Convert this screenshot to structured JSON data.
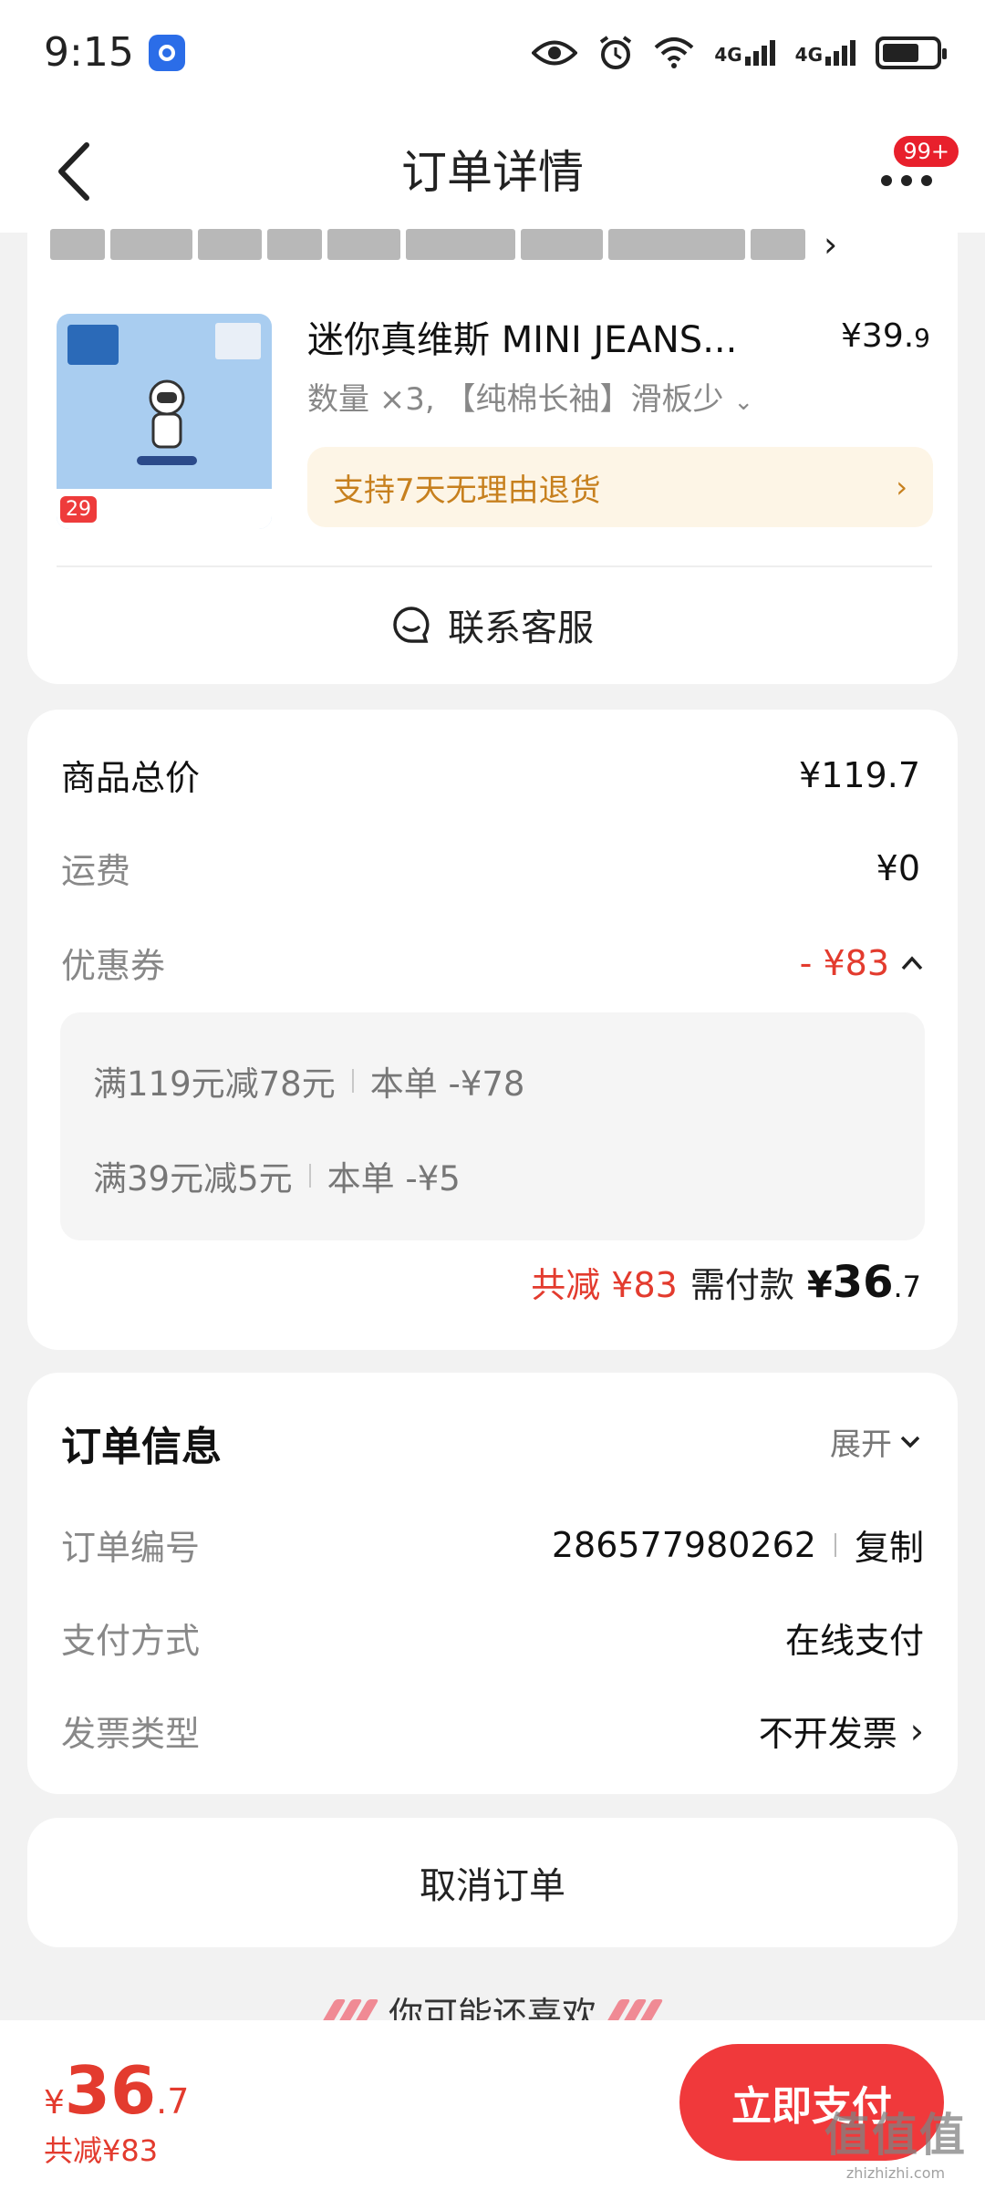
{
  "status_bar": {
    "time": "9:15",
    "signal1": "4G",
    "signal2": "4G"
  },
  "nav": {
    "title": "订单详情",
    "badge": "99+"
  },
  "product": {
    "title": "迷你真维斯 MINI JEANS...",
    "price_int": "¥39.",
    "price_dec": "9",
    "spec": "数量 ×3, 【纯棉长袖】滑板少",
    "image_price": "29",
    "refund_text": "支持7天无理由退货",
    "service_label": "联系客服"
  },
  "price_detail": {
    "total_label": "商品总价",
    "total_value": "¥119.7",
    "shipping_label": "运费",
    "shipping_value": "¥0",
    "coupon_label": "优惠券",
    "coupon_value": "- ¥83",
    "coupons": [
      {
        "rule": "满119元减78元",
        "saving": "本单 -¥78"
      },
      {
        "rule": "满39元减5元",
        "saving": "本单 -¥5"
      }
    ],
    "total_saving": "共减 ¥83",
    "pay_label": "需付款",
    "pay_sym": "¥",
    "pay_int": "36",
    "pay_dec": ".7"
  },
  "order_info": {
    "title": "订单信息",
    "expand_label": "展开",
    "number_label": "订单编号",
    "number_value": "286577980262",
    "copy_label": "复制",
    "payment_label": "支付方式",
    "payment_value": "在线支付",
    "invoice_label": "发票类型",
    "invoice_value": "不开发票"
  },
  "cancel_label": "取消订单",
  "recommend_title": "你可能还喜欢",
  "bottom": {
    "price_sym": "¥",
    "price_int": "36",
    "price_dec": ".7",
    "saving": "共减¥83",
    "pay_button": "立即支付",
    "watermark": "值值值",
    "watermark_url": "zhizhizhi.com"
  },
  "colors": {
    "accent": "#e33b2e",
    "pay_button": "#f0393b",
    "refund_bg": "#fdf5e6",
    "refund_text": "#c7801e"
  }
}
